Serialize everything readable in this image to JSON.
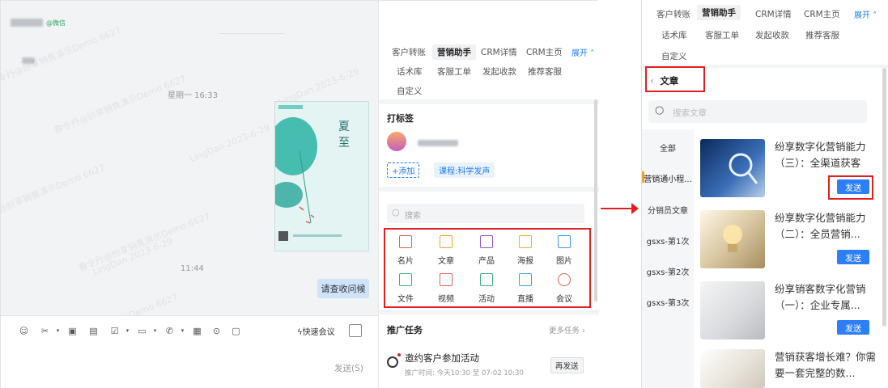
{
  "chat": {
    "contact_tag": "@微信",
    "day_time": "星期一 16:33",
    "time2": "11:44",
    "bubble": "请查收问候",
    "watermark_1": "春令丹@纷享销售演示Demo 6627",
    "watermark_2": "LingDan 2023-6-29",
    "poster_title_1": "夏",
    "poster_title_2": "至",
    "quick_meeting": "快速会议",
    "send": "发送(S)"
  },
  "sidebar": {
    "tabs": [
      "客户转账",
      "营销助手",
      "CRM详情",
      "CRM主页",
      "展开"
    ],
    "tabs_row2": [
      "话术库",
      "客服工单",
      "发起收款",
      "推荐客服"
    ],
    "tabs_row3": [
      "自定义"
    ],
    "tag_title": "打标签",
    "add_tag": "+添加",
    "tag_chip": "课程:科学发声",
    "search_placeholder": "搜索",
    "grid": [
      "名片",
      "文章",
      "产品",
      "海报",
      "图片",
      "文件",
      "视频",
      "活动",
      "直播",
      "会议"
    ],
    "task_title": "推广任务",
    "more_tasks": "更多任务",
    "task_name": "邀约客户参加活动",
    "task_time": "推广时间: 今天10:30 至 07-02 10:30",
    "resend": "再发送"
  },
  "right": {
    "tabs": [
      "客户转账",
      "营销助手",
      "CRM详情",
      "CRM主页",
      "展开"
    ],
    "tabs_row2": [
      "话术库",
      "客服工单",
      "发起收款",
      "推荐客服"
    ],
    "tabs_row3": [
      "自定义"
    ],
    "back_title": "文章",
    "search_placeholder": "搜索文章",
    "categories": [
      "全部",
      "营销通小程...",
      "分销员文章",
      "gsxs-第1次",
      "gsxs-第2次",
      "gsxs-第3次"
    ],
    "articles": [
      {
        "title": "纷享数字化营销能力（三）：全渠道获客",
        "send": "发送"
      },
      {
        "title": "纷享数字化营销能力（二）：全员营销...",
        "send": "发送"
      },
      {
        "title": "纷享销客数字化营销（一）：企业专属...",
        "send": "发送"
      },
      {
        "title": "营销获客增长难？你需要一套完整的数..."
      }
    ]
  }
}
